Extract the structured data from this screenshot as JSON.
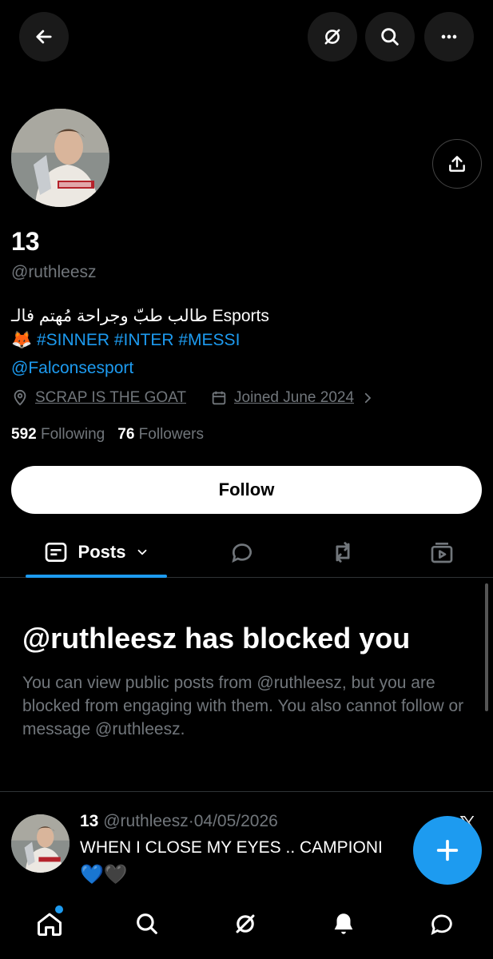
{
  "header": {
    "back_icon": "arrow-left-icon",
    "grok_icon": "grok-icon",
    "search_icon": "search-icon",
    "more_icon": "ellipsis-icon"
  },
  "profile": {
    "display_name": "13",
    "handle": "@ruthleesz",
    "bio_line1": "طالب طبّ وجراحة مُهتم فالـ Esports",
    "bio_line2_emoji": "🦊",
    "bio_line2_tags": "#SINNER #INTER #MESSI",
    "bio_line3": "@Falconsesport",
    "location": "SCRAP IS THE GOAT",
    "joined": "Joined June 2024",
    "following_count": "592",
    "following_label": "Following",
    "followers_count": "76",
    "followers_label": "Followers",
    "follow_button": "Follow"
  },
  "tabs": {
    "posts_label": "Posts"
  },
  "blocked": {
    "title": "@ruthleesz has blocked you",
    "description": "You can view public posts from @ruthleesz, but you are blocked from engaging with them. You also cannot follow or message @ruthleesz."
  },
  "post": {
    "name": "13",
    "handle": "@ruthleesz",
    "separator": "·",
    "date": "04/05/2026",
    "text": "WHEN I CLOSE MY EYES .. CAMPIONI",
    "hearts": "💙🖤",
    "x_logo": "𝕏"
  },
  "colors": {
    "accent": "#1d9bf0",
    "background": "#000000",
    "muted": "#71767b"
  }
}
